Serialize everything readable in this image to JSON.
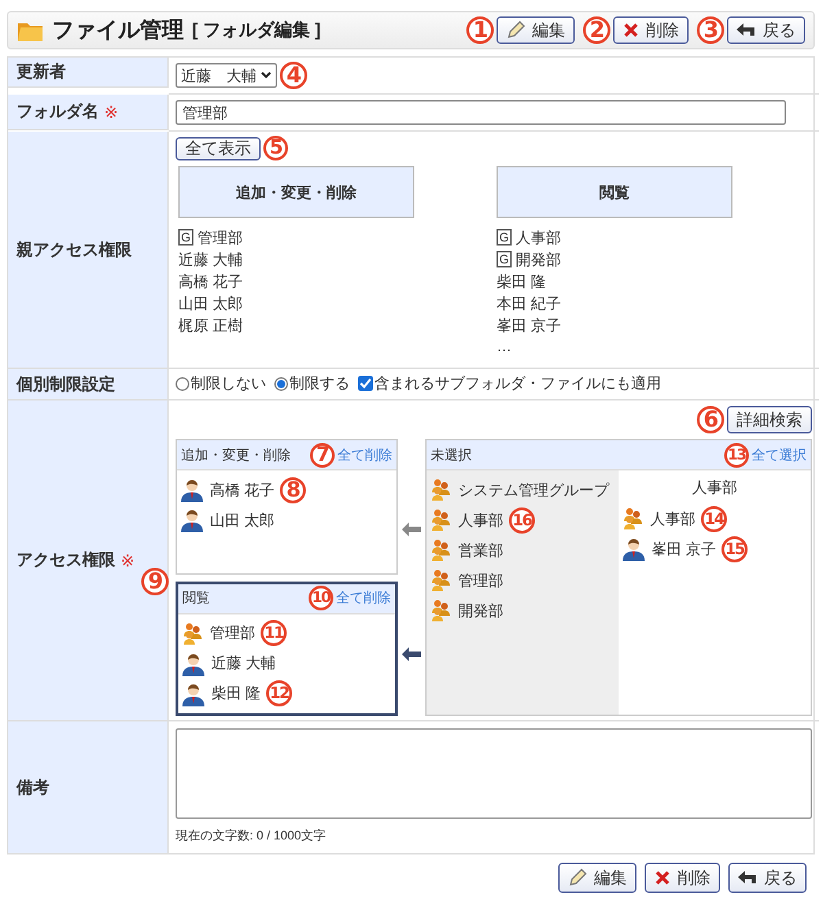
{
  "header": {
    "title": "ファイル管理",
    "subtitle": "[ フォルダ編集 ]",
    "buttons": [
      {
        "kind": "edit",
        "label": "編集",
        "callout": "1"
      },
      {
        "kind": "delete",
        "label": "削除",
        "callout": "2"
      },
      {
        "kind": "back",
        "label": "戻る",
        "callout": "3"
      }
    ]
  },
  "form": {
    "updater": {
      "label": "更新者",
      "value": "近藤　大輔",
      "callout": "4"
    },
    "folder_name": {
      "label": "フォルダ名",
      "required_mark": "※",
      "value": "管理部"
    },
    "parent_access": {
      "label": "親アクセス権限",
      "show_all_button": {
        "label": "全て表示",
        "callout": "5"
      },
      "columns": [
        {
          "heading": "追加・変更・削除",
          "entries": [
            {
              "kind": "group",
              "badge": "G",
              "name": "管理部"
            },
            {
              "kind": "user",
              "name": "近藤 大輔"
            },
            {
              "kind": "user",
              "name": "高橋 花子"
            },
            {
              "kind": "user",
              "name": "山田 太郎"
            },
            {
              "kind": "user",
              "name": "梶原 正樹"
            }
          ]
        },
        {
          "heading": "閲覧",
          "entries": [
            {
              "kind": "group",
              "badge": "G",
              "name": "人事部"
            },
            {
              "kind": "group",
              "badge": "G",
              "name": "開発部"
            },
            {
              "kind": "user",
              "name": "柴田 隆"
            },
            {
              "kind": "user",
              "name": "本田 紀子"
            },
            {
              "kind": "user",
              "name": "峯田 京子"
            },
            {
              "kind": "more",
              "name": "…"
            }
          ]
        }
      ]
    },
    "restriction": {
      "label": "個別制限設定",
      "options": [
        {
          "label": "制限しない",
          "selected": false
        },
        {
          "label": "制限する",
          "selected": true
        }
      ],
      "apply_to_children": {
        "label": "含まれるサブフォルダ・ファイルにも適用",
        "checked": true
      }
    },
    "access": {
      "label": "アクセス権限",
      "required_mark": "※",
      "search_button": {
        "label": "詳細検索",
        "callout": "6"
      },
      "lists": [
        {
          "title": "追加・変更・削除",
          "clear_link": "全て削除",
          "link_callout": "7",
          "selected": false,
          "entries": [
            {
              "kind": "user",
              "name": "高橋 花子",
              "callout": "8"
            },
            {
              "kind": "user",
              "name": "山田 太郎"
            }
          ]
        },
        {
          "title": "閲覧",
          "clear_link": "全て削除",
          "link_callout": "10",
          "callout": "9",
          "selected": true,
          "entries": [
            {
              "kind": "group",
              "name": "管理部",
              "callout": "11"
            },
            {
              "kind": "user",
              "name": "近藤 大輔"
            },
            {
              "kind": "user",
              "name": "柴田 隆",
              "callout": "12"
            }
          ]
        }
      ],
      "unselected": {
        "title": "未選択",
        "select_all_link": "全て選択",
        "link_callout": "13",
        "groups": [
          {
            "name": "システム管理グループ"
          },
          {
            "name": "人事部",
            "callout": "16"
          },
          {
            "name": "営業部"
          },
          {
            "name": "管理部"
          },
          {
            "name": "開発部"
          }
        ],
        "members_heading": "人事部",
        "members": [
          {
            "kind": "group",
            "name": "人事部",
            "callout": "14"
          },
          {
            "kind": "user",
            "name": "峯田 京子",
            "callout": "15"
          }
        ]
      }
    },
    "remarks": {
      "label": "備考",
      "counter": "現在の文字数: 0 / 1000文字"
    }
  },
  "footer_buttons": [
    {
      "kind": "edit",
      "label": "編集"
    },
    {
      "kind": "delete",
      "label": "削除"
    },
    {
      "kind": "back",
      "label": "戻る"
    }
  ]
}
